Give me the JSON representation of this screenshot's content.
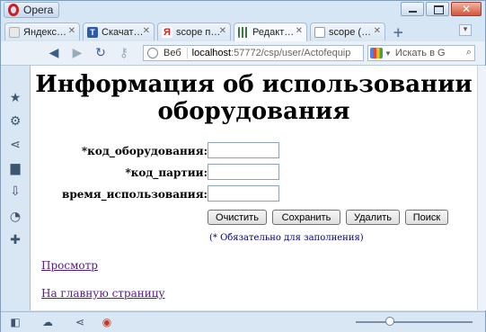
{
  "window": {
    "app_label": "Opera"
  },
  "tabs": [
    {
      "label": "Яндекс…",
      "favicon_color": "#e8e8e8"
    },
    {
      "label": "Скачат…",
      "favicon_color": "#2a5caa"
    },
    {
      "label": "scope п…",
      "favicon_color": "#e02020"
    },
    {
      "label": "Редакт…",
      "favicon_color": "#3a7d3a"
    },
    {
      "label": "scope (…",
      "favicon_color": "#cccccc"
    }
  ],
  "toolbar": {
    "address_prefix": "Веб",
    "address_host": "localhost",
    "address_path": ":57772/csp/user/Actofequip",
    "search_placeholder": "Искать в G"
  },
  "page": {
    "title": "Информация об использовании оборудования",
    "fields": [
      {
        "label": "*код_оборудования:",
        "value": ""
      },
      {
        "label": "*код_партии:",
        "value": ""
      },
      {
        "label": "время_использования:",
        "value": ""
      }
    ],
    "buttons": [
      "Очистить",
      "Сохранить",
      "Удалить",
      "Поиск"
    ],
    "required_note": "(* Обязательно для заполнения)",
    "links": [
      "Просмотр",
      "На главную страницу"
    ]
  },
  "colors": {
    "link": "#551a8b",
    "note": "#000080",
    "chrome": "#d7e6f5"
  }
}
